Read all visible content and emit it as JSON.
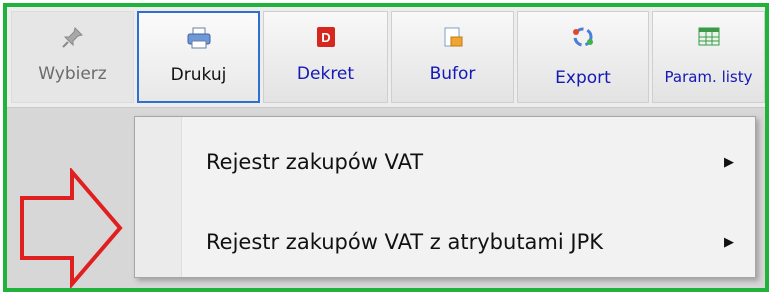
{
  "toolbar": {
    "buttons": [
      {
        "label": "Wybierz",
        "icon": "pin-icon"
      },
      {
        "label": "Drukuj",
        "icon": "printer-icon"
      },
      {
        "label": "Dekret",
        "icon": "dekret-icon"
      },
      {
        "label": "Bufor",
        "icon": "buffer-icon"
      },
      {
        "label": "Export",
        "icon": "export-icon"
      },
      {
        "label": "Param. listy",
        "icon": "table-icon"
      }
    ]
  },
  "dekret_icon_letter": "D",
  "menu": {
    "items": [
      {
        "label": "Rejestr zakupów VAT"
      },
      {
        "label": "Rejestr zakupów VAT z atrybutami JPK"
      }
    ]
  },
  "colors": {
    "frame_border": "#20b33c",
    "annotation_arrow": "#e02020",
    "link_label": "#1418b4",
    "active_border": "#2f6fd0"
  }
}
